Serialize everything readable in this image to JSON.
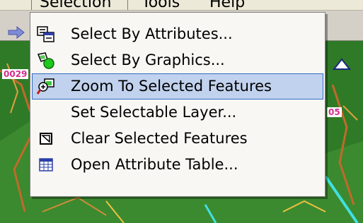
{
  "menubar": {
    "items": [
      "Selection",
      "Tools",
      "Help"
    ]
  },
  "map": {
    "labels": [
      "0029",
      "05"
    ]
  },
  "selection_menu": {
    "items": [
      {
        "label": "Select By Attributes...",
        "icon": "select-by-attributes-icon",
        "highlighted": false
      },
      {
        "label": "Select By Graphics...",
        "icon": "select-by-graphics-icon",
        "highlighted": false
      },
      {
        "label": "Zoom To Selected Features",
        "icon": "zoom-to-selected-icon",
        "highlighted": true
      },
      {
        "label": "Set Selectable Layer...",
        "icon": "",
        "highlighted": false
      },
      {
        "label": "Clear Selected Features",
        "icon": "clear-selected-icon",
        "highlighted": false
      },
      {
        "label": "Open Attribute Table...",
        "icon": "attribute-table-icon",
        "highlighted": false
      }
    ]
  },
  "colors": {
    "highlight_fill": "#c1d2ee",
    "highlight_border": "#316ac5",
    "menu_background": "#f8f7f3",
    "map_background": "#2f7a27"
  }
}
